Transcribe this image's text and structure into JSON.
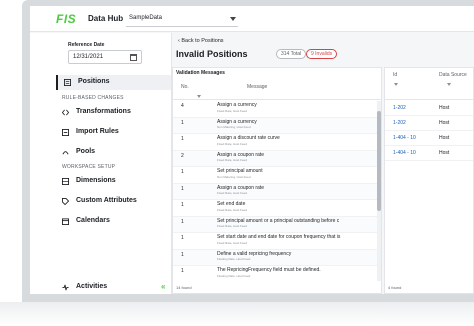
{
  "app": {
    "logo": "FIS",
    "title": "Data Hub",
    "dataset": "SampleData"
  },
  "sidebar": {
    "reference_date_label": "Reference Date",
    "reference_date": "12/31/2021",
    "items": [
      {
        "label": "Positions",
        "icon": "positions-icon",
        "active": true
      },
      {
        "label": "Transformations",
        "icon": "code-icon"
      },
      {
        "label": "Import Rules",
        "icon": "import-icon"
      },
      {
        "label": "Pools",
        "icon": "pools-icon"
      },
      {
        "label": "Dimensions",
        "icon": "dimensions-icon"
      },
      {
        "label": "Custom Attributes",
        "icon": "tag-icon"
      },
      {
        "label": "Calendars",
        "icon": "calendar-icon"
      },
      {
        "label": "Activities",
        "icon": "activities-icon"
      }
    ],
    "sections": [
      "RULE-BASED CHANGES",
      "WORKSPACE SETUP"
    ],
    "collapse_glyph": "«"
  },
  "main": {
    "back_label": "Back to Positions",
    "title": "Invalid Positions",
    "total_badge": "314 Total",
    "invalid_badge": "9 Invalids"
  },
  "validation": {
    "title": "Validation Messages",
    "columns": [
      "No.",
      "Message"
    ],
    "rows": [
      {
        "no": "4",
        "message": "Assign a currency",
        "sub": "Fixed Rate, Host Feed"
      },
      {
        "no": "1",
        "message": "Assign a currency",
        "sub": "Non Maturing, Host Feed"
      },
      {
        "no": "1",
        "message": "Assign a discount rate curve",
        "sub": "Fixed Rate, Host Feed"
      },
      {
        "no": "2",
        "message": "Assign a coupon rate",
        "sub": "Fixed Rate, Host Feed"
      },
      {
        "no": "1",
        "message": "Set principal amount",
        "sub": "Non Maturing, Host Feed"
      },
      {
        "no": "1",
        "message": "Assign a coupon rate",
        "sub": "Fixed Rate, Host Feed"
      },
      {
        "no": "1",
        "message": "Set end date",
        "sub": "Fixed Rate, Host Feed"
      },
      {
        "no": "1",
        "message": "Set principal amount or a principal outstanding before c",
        "sub": "Fixed Rate, Host Feed"
      },
      {
        "no": "1",
        "message": "Set start date and end date for coupon frequency that is",
        "sub": "Fixed Rate, Host Feed"
      },
      {
        "no": "1",
        "message": "Define a valid repricing frequency",
        "sub": "Floating Rate, Host Feed"
      },
      {
        "no": "1",
        "message": "The RepricingFrequency field must be defined.",
        "sub": "Floating Rate, Host Feed"
      }
    ],
    "found": "14 found"
  },
  "positions": {
    "columns": [
      "Id",
      "Data Source"
    ],
    "rows": [
      {
        "id": "1-202",
        "source": "Host"
      },
      {
        "id": "1-202",
        "source": "Host"
      },
      {
        "id": "1-404 - 10",
        "source": "Host"
      },
      {
        "id": "1-404 - 10",
        "source": "Host"
      }
    ],
    "found": "4 found"
  }
}
